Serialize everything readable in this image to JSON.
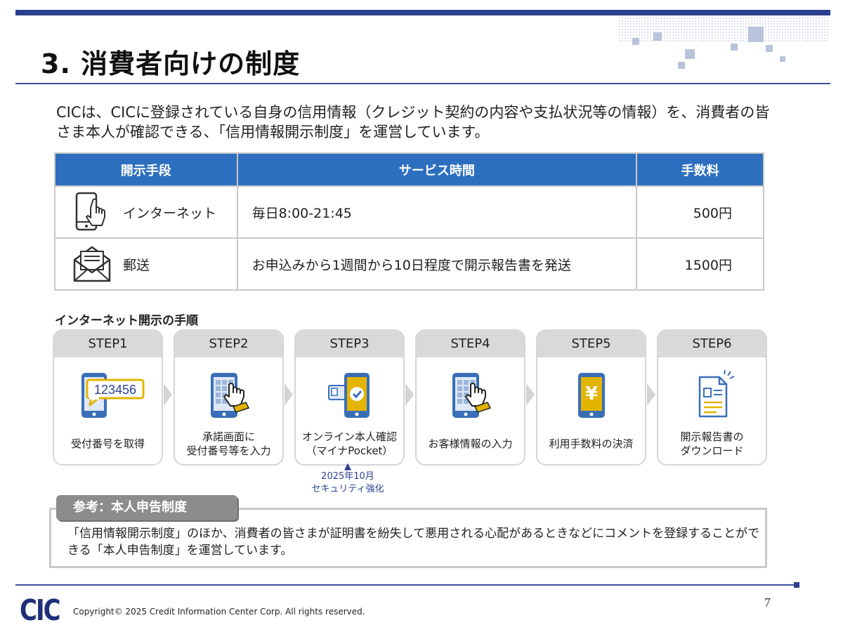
{
  "slide": {
    "title": "3. 消費者向けの制度",
    "intro": "CICは、CICに登録されている自身の信用情報（クレジット契約の内容や支払状況等の情報）を、消費者の皆さま本人が確認できる、「信用情報開示制度」を運営しています。"
  },
  "table": {
    "headers": [
      "開示手段",
      "サービス時間",
      "手数料"
    ],
    "rows": [
      {
        "icon": "smartphone-touch-icon",
        "method": "インターネット",
        "time": "毎日8:00-21:45",
        "fee": "500円"
      },
      {
        "icon": "mail-envelope-icon",
        "method": "郵送",
        "time": "お申込みから1週間から10日程度で開示報告書を発送",
        "fee": "1500円"
      }
    ]
  },
  "steps": {
    "label": "インターネット開示の手順",
    "items": [
      {
        "step": "STEP1",
        "text": "受付番号を取得",
        "icon": "phone-receipt-number-icon",
        "code": "123456"
      },
      {
        "step": "STEP2",
        "text": "承諾画面に\n受付番号等を入力",
        "icon": "phone-input-icon"
      },
      {
        "step": "STEP3",
        "text": "オンライン本人確認\n（マイナPocket）",
        "icon": "phone-id-verification-icon"
      },
      {
        "step": "STEP4",
        "text": "お客様情報の入力",
        "icon": "phone-input-icon"
      },
      {
        "step": "STEP5",
        "text": "利用手数料の決済",
        "icon": "phone-yen-payment-icon",
        "symbol": "¥"
      },
      {
        "step": "STEP6",
        "text": "開示報告書の\nダウンロード",
        "icon": "document-download-icon"
      }
    ],
    "note": {
      "arrow": "▲",
      "text": "2025年10月\nセキュリティ強化"
    }
  },
  "reference": {
    "tab": "参考：本人申告制度",
    "body": "「信用情報開示制度」のほか、消費者の皆さまが証明書を紛失して悪用される心配があるときなどにコメントを登録することができる「本人申告制度」を運営しています。"
  },
  "footer": {
    "logo": "CIC",
    "copyright": "Copyright© 2025 Credit Information Center Corp. All rights reserved.",
    "page": "7"
  },
  "colors": {
    "header_blue": "#2d6fbf",
    "navy": "#2b3f8f",
    "accent_yellow": "#e3b400",
    "icon_blue": "#3a6fb8"
  }
}
